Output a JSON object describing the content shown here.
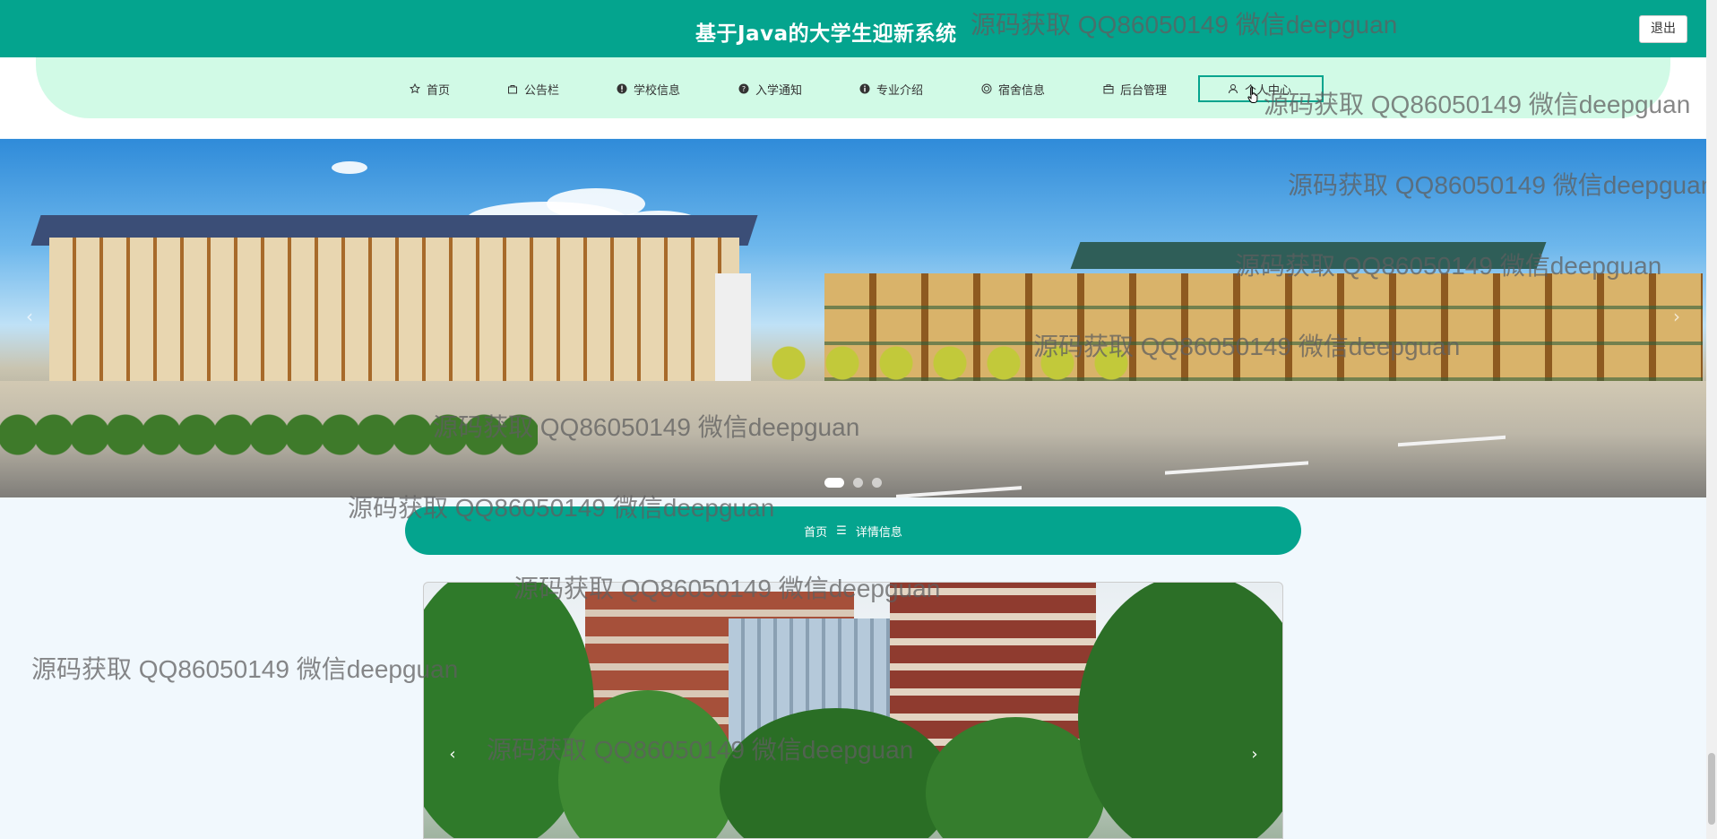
{
  "header": {
    "title": "基于Java的大学生迎新系统",
    "logout_label": "退出"
  },
  "nav": {
    "items": [
      {
        "label": "首页",
        "icon": "star-icon"
      },
      {
        "label": "公告栏",
        "icon": "bag-icon"
      },
      {
        "label": "学校信息",
        "icon": "info-icon"
      },
      {
        "label": "入学通知",
        "icon": "question-icon"
      },
      {
        "label": "专业介绍",
        "icon": "info-icon"
      },
      {
        "label": "宿舍信息",
        "icon": "target-icon"
      },
      {
        "label": "后台管理",
        "icon": "briefcase-icon"
      },
      {
        "label": "个人中心",
        "icon": "user-icon"
      }
    ]
  },
  "breadcrumb": {
    "home": "首页",
    "separator": "☰",
    "current": "详情信息"
  },
  "banner": {
    "slides": 3,
    "active_slide": 1
  },
  "watermark": {
    "text": "源码获取 QQ86050149 微信deepguan"
  },
  "colors": {
    "primary": "#04a48e",
    "nav_bg": "#d1fae6",
    "page_bg": "#f1f8fd"
  }
}
